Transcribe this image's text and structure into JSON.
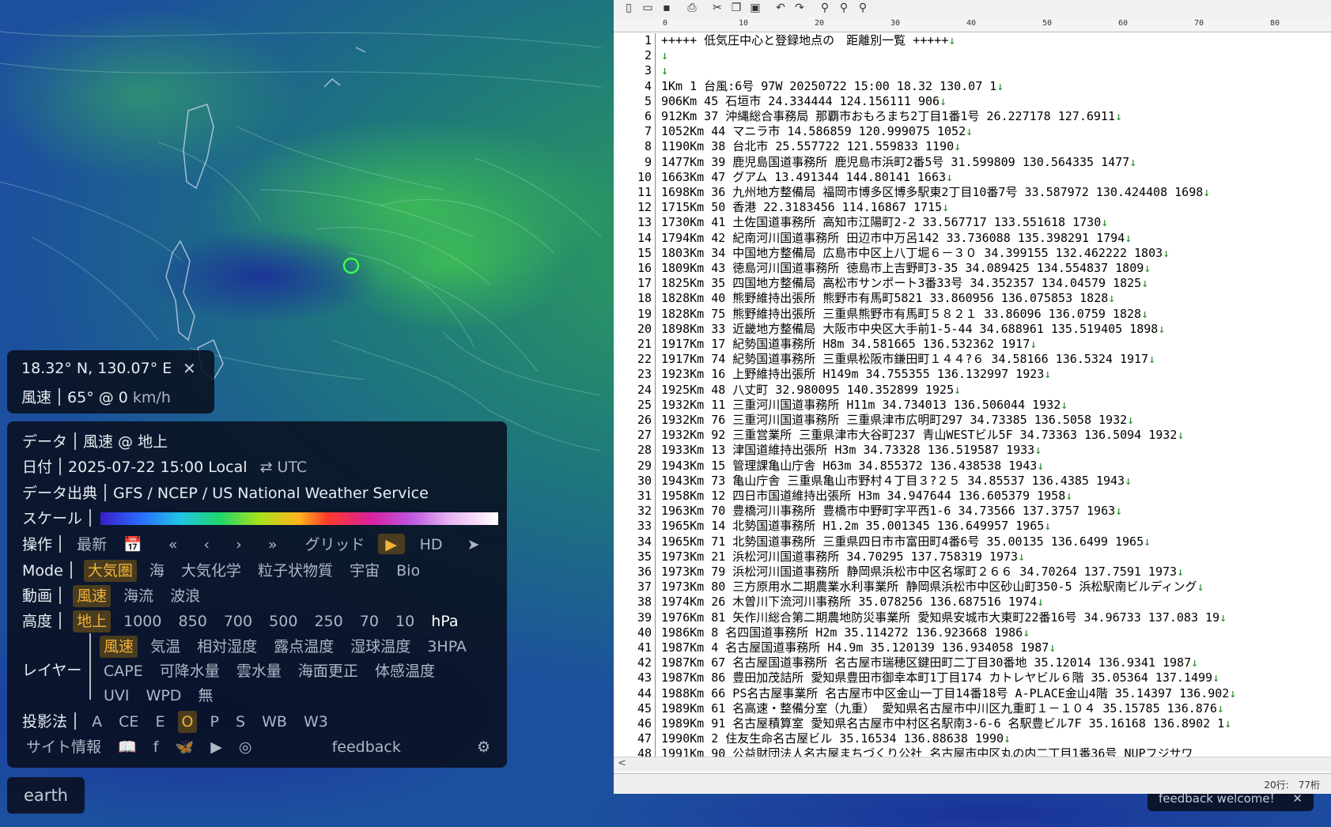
{
  "location_popup": {
    "coords": "18.32° N, 130.07° E",
    "close": "✕",
    "metric_label": "風速",
    "metric_value": "65° @ 0",
    "metric_unit": "km/h"
  },
  "panel": {
    "data_label": "データ",
    "data_value": "風速 @ 地上",
    "date_label": "日付",
    "date_value": "2025-07-22 15:00 Local",
    "date_swap": "⇄",
    "date_utc": "UTC",
    "source_label": "データ出典",
    "source_value": "GFS / NCEP / US National Weather Service",
    "scale_label": "スケール",
    "ops_label": "操作",
    "ops_latest": "最新",
    "ops_cal": "📅",
    "ops_first": "«",
    "ops_prev": "‹",
    "ops_next": "›",
    "ops_last": "»",
    "ops_grid": "グリッド",
    "ops_play": "▶",
    "ops_hd": "HD",
    "ops_locate": "➤",
    "mode_label": "Mode",
    "mode_items": [
      "大気圏",
      "海",
      "大気化学",
      "粒子状物質",
      "宇宙",
      "Bio"
    ],
    "anim_label": "動画",
    "anim_items": [
      "風速",
      "海流",
      "波浪"
    ],
    "height_label": "高度",
    "height_items": [
      "地上",
      "1000",
      "850",
      "700",
      "500",
      "250",
      "70",
      "10",
      "hPa"
    ],
    "layer_label": "レイヤー",
    "layer_row1": [
      "風速",
      "気温",
      "相対湿度",
      "露点温度",
      "湿球温度",
      "3HPA"
    ],
    "layer_row2": [
      "CAPE",
      "可降水量",
      "雲水量",
      "海面更正",
      "体感温度"
    ],
    "layer_row3": [
      "UVI",
      "WPD",
      "無"
    ],
    "proj_label": "投影法",
    "proj_items": [
      "A",
      "CE",
      "E",
      "O",
      "P",
      "S",
      "WB",
      "W3"
    ],
    "footer_about": "サイト情報",
    "footer_feedback": "feedback",
    "footer_icons": [
      "📖",
      "f",
      "🦋",
      "▶",
      "◎"
    ],
    "footer_gear": "⚙"
  },
  "earth_label": "earth",
  "feedback_welcome": "feedback welcome!",
  "feedback_close": "✕",
  "editor": {
    "ruler_ticks": [
      "0",
      "10",
      "20",
      "30",
      "40",
      "50",
      "60",
      "70",
      "80"
    ],
    "lines": [
      "+++++ 低気圧中心と登録地点の　距離別一覧 +++++",
      "",
      "",
      "1Km  1  台風:6号 97W    20250722   15:00         18.32    130.07  1",
      "906Km  45        石垣市          24.334444        124.156111       906",
      "912Km  37        沖縄総合事務局  那覇市おもろまち2丁目1番1号      26.227178        127.6911",
      "1052Km  44 マニラ市 14.586859 120.999075 1052",
      "1190Km  38 台北市 25.557722 121.559833 1190",
      "1477Km  39 鹿児島国道事務所 鹿児島市浜町2番5号 31.599809 130.564335 1477",
      "1663Km  47 グアム 13.491344 144.80141 1663",
      "1698Km  36 九州地方整備局 福岡市博多区博多駅東2丁目10番7号 33.587972 130.424408 1698",
      "1715Km  50 香港 22.3183456 114.16867 1715",
      "1730Km  41 土佐国道事務所 高知市江陽町2-2 33.567717 133.551618 1730",
      "1794Km  42 紀南河川国道事務所 田辺市中万呂142 33.736088 135.398291 1794",
      "1803Km  34 中国地方整備局 広島市中区上八丁堀６－３０ 34.399155 132.462222 1803",
      "1809Km  43 徳島河川国道事務所 徳島市上吉野町3-35 34.089425 134.554837 1809",
      "1825Km  35 四国地方整備局 高松市サンポート3番33号 34.352357 134.04579 1825",
      "1828Km  40 熊野維持出張所 熊野市有馬町5821 33.860956 136.075853 1828",
      "1828Km  75 熊野維持出張所 三重県熊野市有馬町５８２１ 33.86096 136.0759 1828",
      "1898Km  33 近畿地方整備局 大阪市中央区大手前1-5-44 34.688961 135.519405 1898",
      "1917Km  17 紀勢国道事務所 H8m 34.581665 136.532362 1917",
      "1917Km  74 紀勢国道事務所 三重県松阪市鎌田町１４４?６ 34.58166 136.5324 1917",
      "1923Km  16 上野維持出張所 H149m 34.755355 136.132997 1923",
      "1925Km  48 八丈町 32.980095 140.352899 1925",
      "1932Km  11 三重河川国道事務所 H11m 34.734013 136.506044 1932",
      "1932Km  76 三重河川国道事務所 三重県津市広明町297 34.73385 136.5058 1932",
      "1932Km  92 三重営業所 三重県津市大谷町237 青山WESTビル5F 34.73363 136.5094 1932",
      "1933Km  13 津国道維持出張所 H3m 34.73328 136.519587 1933",
      "1943Km  15 管理課亀山庁舎 H63m 34.855372 136.438538 1943",
      "1943Km  73 亀山庁舎 三重県亀山市野村４丁目３?２５ 34.85537 136.4385 1943",
      "1958Km  12 四日市国道維持出張所 H3m 34.947644 136.605379 1958",
      "1963Km  70 豊橋河川事務所 豊橋市中野町字平西1-6 34.73566 137.3757 1963",
      "1965Km  14 北勢国道事務所 H1.2m 35.001345 136.649957 1965",
      "1965Km  71 北勢国道事務所 三重県四日市市富田町4番6号 35.00135 136.6499 1965",
      "1973Km  21 浜松河川国道事務所 34.70295 137.758319 1973",
      "1973Km  79 浜松河川国道事務所 静岡県浜松市中区名塚町２６６ 34.70264 137.7591 1973",
      "1973Km  80 三方原用水二期農業水利事業所 静岡県浜松市中区砂山町350-5 浜松駅南ビルディング",
      "1974Km  26 木曽川下流河川事務所 35.078256 136.687516 1974",
      "1976Km  81 矢作川総合第二期農地防災事業所 愛知県安城市大東町22番16号 34.96733 137.083 19",
      "1986Km  8 名四国道事務所 H2m 35.114272 136.923668 1986",
      "1987Km  4 名古屋国道事務所 H4.9m 35.120139 136.934058 1987",
      "1987Km  67 名古屋国道事務所 名古屋市瑞穂区鍵田町二丁目30番地 35.12014 136.9341 1987",
      "1987Km  86 豊田加茂詰所 愛知県豊田市御幸本町1丁目174 カトレヤビル６階 35.05364 137.1499",
      "1988Km  66 PS名古屋事業所 名古屋市中区金山一丁目14番18号 A-PLACE金山4階 35.14397 136.902",
      "1989Km  61 名高速・整備分室（九重） 愛知県名古屋市中川区九重町１－１０４ 35.15785 136.876",
      "1989Km  91 名古屋積算室 愛知県名古屋市中村区名駅南3-6-6 名駅豊ビル7F 35.16168 136.8902 1",
      "1990Km  2 住友生命名古屋ビル 35.16534 136.88638 1990",
      "1991Km  90 公益財団法人名古屋まちづくり公社 名古屋市中区丸の内二丁目1番36号 NUPフジサワ"
    ],
    "eol_mark": "↓",
    "eol_last": "",
    "status": "20行:　77桁",
    "scroll_left": "<"
  }
}
